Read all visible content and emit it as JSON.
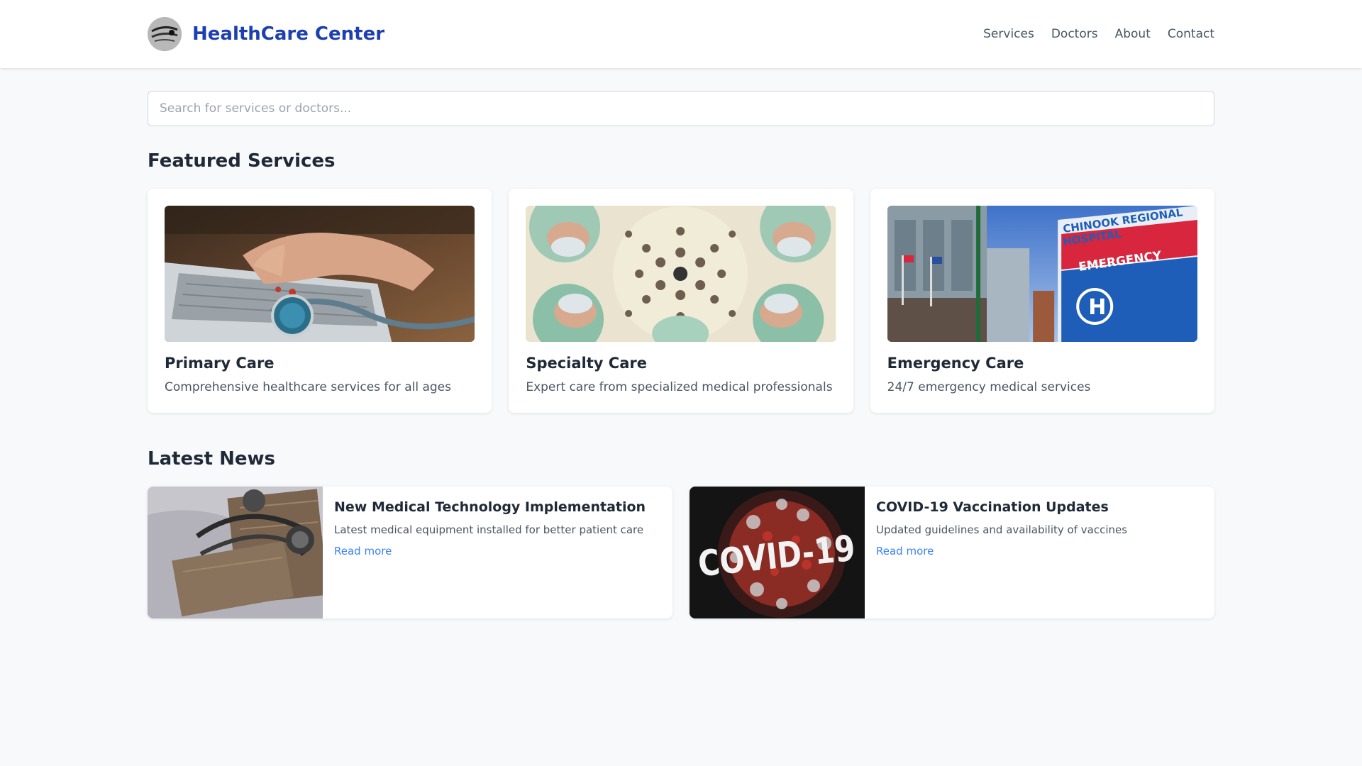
{
  "header": {
    "brand": "HealthCare Center",
    "logo_icon": "stethoscope-logo-icon",
    "nav": [
      {
        "label": "Services"
      },
      {
        "label": "Doctors"
      },
      {
        "label": "About"
      },
      {
        "label": "Contact"
      }
    ]
  },
  "search": {
    "placeholder": "Search for services or doctors...",
    "value": ""
  },
  "featured": {
    "title": "Featured Services",
    "cards": [
      {
        "title": "Primary Care",
        "description": "Comprehensive healthcare services for all ages",
        "image": "laptop-stethoscope-photo"
      },
      {
        "title": "Specialty Care",
        "description": "Expert care from specialized medical professionals",
        "image": "surgeons-operating-light-photo"
      },
      {
        "title": "Emergency Care",
        "description": "24/7 emergency medical services",
        "image": "hospital-emergency-sign-photo"
      }
    ]
  },
  "news": {
    "title": "Latest News",
    "items": [
      {
        "title": "New Medical Technology Implementation",
        "description": "Latest medical equipment installed for better patient care",
        "link": "Read more",
        "image": "stethoscope-photo"
      },
      {
        "title": "COVID-19 Vaccination Updates",
        "description": "Updated guidelines and availability of vaccines",
        "link": "Read more",
        "image": "covid-19-virus-photo",
        "image_text": "COVID-19"
      }
    ]
  },
  "photo_text": {
    "hospital_sign_line1": "CHINOOK REGIONAL",
    "hospital_sign_line2": "HOSPITAL",
    "emergency": "EMERGENCY",
    "h_symbol": "H"
  },
  "colors": {
    "brand": "#1e40af",
    "link": "#3b82f6",
    "background": "#f8f9fb"
  }
}
